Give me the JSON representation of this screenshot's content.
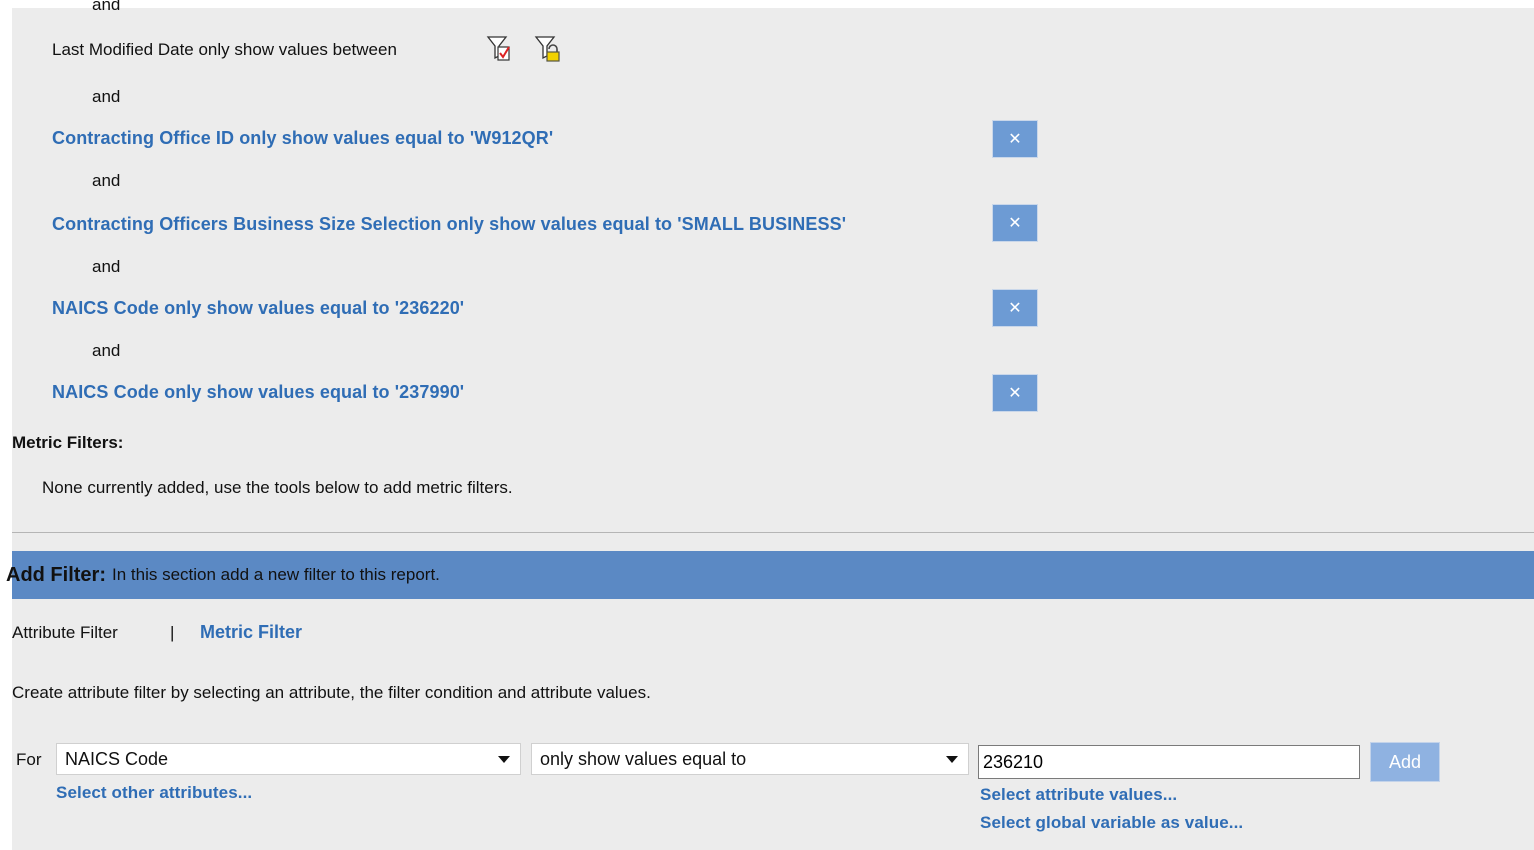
{
  "filters": {
    "cutoff_text": "and",
    "last_modified": {
      "label": "Last Modified Date only show values between"
    },
    "connector": "and",
    "items": [
      {
        "text": "Contracting Office ID only show values equal to 'W912QR'",
        "remove_symbol": "✕"
      },
      {
        "text": "Contracting Officers Business Size Selection only show values equal to 'SMALL BUSINESS'",
        "remove_symbol": "✕"
      },
      {
        "text": "NAICS Code only show values equal to '236220'",
        "remove_symbol": "✕"
      },
      {
        "text": "NAICS Code only show values equal to '237990'",
        "remove_symbol": "✕"
      }
    ]
  },
  "metric_filters": {
    "heading": "Metric Filters:",
    "empty_message": "None currently added, use the tools below to add metric filters."
  },
  "add_filter": {
    "title": "Add Filter:",
    "description": "In this section add a new filter to this report.",
    "tabs": {
      "attribute": "Attribute Filter",
      "separator": "|",
      "metric": "Metric Filter"
    },
    "instruction": "Create attribute filter by selecting an attribute, the filter condition and attribute values.",
    "for_label": "For",
    "attribute_select": "NAICS Code",
    "condition_select": "only show values equal to",
    "value_input": "236210",
    "add_button": "Add",
    "select_other_attributes": "Select other attributes...",
    "select_attribute_values": "Select attribute values...",
    "select_global_variable": "Select global variable as value..."
  },
  "colors": {
    "link": "#2f6db5",
    "bar": "#5b89c4",
    "remove_button": "#6d9bd4",
    "panel": "#ececec"
  }
}
